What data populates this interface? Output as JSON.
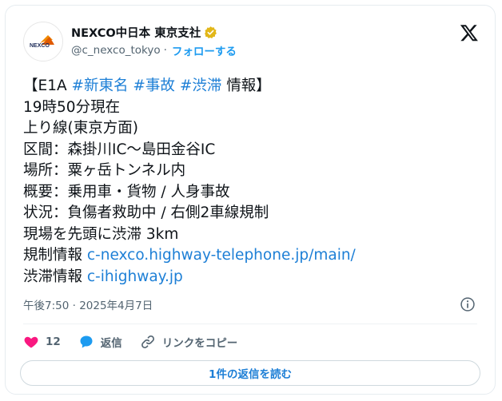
{
  "author": {
    "display_name": "NEXCO中日本 東京支社",
    "handle": "@c_nexco_tokyo",
    "separator": "·",
    "follow_label": "フォローする",
    "avatar_text": "NEXCO"
  },
  "tweet": {
    "line1": {
      "prefix": "【E1A ",
      "tag1": "#新東名",
      "tag2": "#事故",
      "tag3": "#渋滞",
      "suffix": " 情報】"
    },
    "line2": "19時50分現在",
    "line3": "上り線(東京方面)",
    "line4": "区間：森掛川IC〜島田金谷IC",
    "line5": "場所：粟ヶ岳トンネル内",
    "line6": "概要：乗用車・貨物 / 人身事故",
    "line7": "状況：負傷者救助中 / 右側2車線規制",
    "line8": "現場を先頭に渋滞 3km",
    "line9": {
      "label": "規制情報 ",
      "link": "c-nexco.highway-telephone.jp/main/"
    },
    "line10": {
      "label": "渋滞情報 ",
      "link": "c-ihighway.jp"
    }
  },
  "timestamp": "午後7:50 · 2025年4月7日",
  "actions": {
    "like_count": "12",
    "reply_label": "返信",
    "copy_link_label": "リンクをコピー"
  },
  "read_replies_label": "1件の返信を読む",
  "colors": {
    "link": "#1d7fd6",
    "like": "#f91880",
    "reply": "#1d9bf0",
    "verified": "#e2b719"
  }
}
